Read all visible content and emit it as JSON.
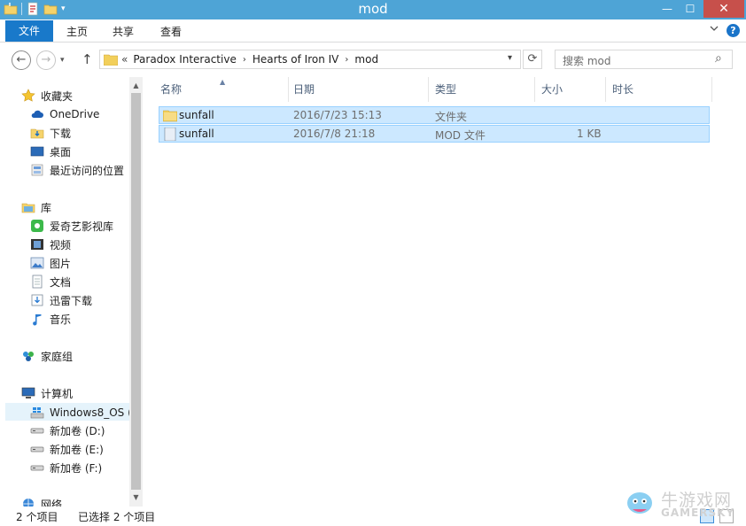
{
  "window": {
    "title": "mod",
    "controls": {
      "minimize": "—",
      "maximize": "☐",
      "close": "✕"
    }
  },
  "ribbon": {
    "tabs": [
      "文件",
      "主页",
      "共享",
      "查看"
    ],
    "expand_icon": "chevron-down-icon",
    "help": "?"
  },
  "address": {
    "overflow": "«",
    "crumbs": [
      "Paradox Interactive",
      "Hearts of Iron IV",
      "mod"
    ],
    "search_placeholder": "搜索 mod"
  },
  "nav": {
    "favorites": {
      "label": "收藏夹",
      "items": [
        "OneDrive",
        "下载",
        "桌面",
        "最近访问的位置"
      ]
    },
    "library": {
      "label": "库",
      "items": [
        "爱奇艺影视库",
        "视频",
        "图片",
        "文档",
        "迅雷下载",
        "音乐"
      ]
    },
    "homegroup": "家庭组",
    "computer": {
      "label": "计算机",
      "items": [
        "Windows8_OS (",
        "新加卷 (D:)",
        "新加卷 (E:)",
        "新加卷 (F:)"
      ]
    },
    "network": "网络"
  },
  "columns": [
    "名称",
    "日期",
    "类型",
    "大小",
    "时长"
  ],
  "files": [
    {
      "name": "sunfall",
      "date": "2016/7/23 15:13",
      "type": "文件夹",
      "size": "",
      "icon": "folder-icon"
    },
    {
      "name": "sunfall",
      "date": "2016/7/8 21:18",
      "type": "MOD 文件",
      "size": "1 KB",
      "icon": "file-icon"
    }
  ],
  "status": {
    "count": "2 个项目",
    "selected": "已选择 2 个项目"
  },
  "watermark": {
    "line1": "牛游戏网",
    "line2": "GAMERSKY"
  },
  "colors": {
    "titlebar": "#4ea4d6",
    "file_tab": "#1979ca",
    "close": "#c7504b",
    "selection": "#cce8ff",
    "selection_border": "#99d1ff"
  }
}
